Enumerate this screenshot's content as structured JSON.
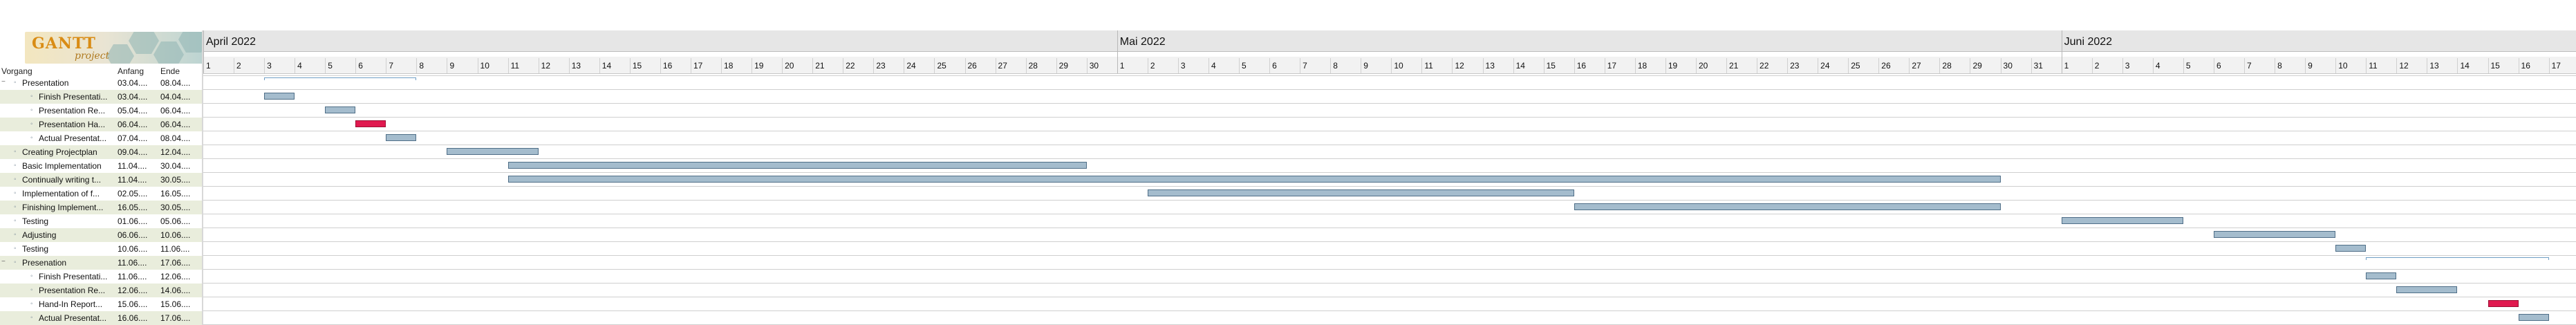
{
  "logo": {
    "text": "GANTT",
    "subtext": "project"
  },
  "table": {
    "headers": {
      "name": "Vorgang",
      "start": "Anfang",
      "end": "Ende"
    },
    "rows": [
      {
        "name": "Presentation",
        "start": "03.04....",
        "end": "08.04....",
        "level": 0,
        "toggle": "−"
      },
      {
        "name": "Finish Presentati...",
        "start": "03.04....",
        "end": "04.04....",
        "level": 1
      },
      {
        "name": "Presentation Re...",
        "start": "05.04....",
        "end": "06.04....",
        "level": 1
      },
      {
        "name": "Presentation Ha...",
        "start": "06.04....",
        "end": "06.04....",
        "level": 1
      },
      {
        "name": "Actual Presentat...",
        "start": "07.04....",
        "end": "08.04....",
        "level": 1
      },
      {
        "name": "Creating Projectplan",
        "start": "09.04....",
        "end": "12.04....",
        "level": 0
      },
      {
        "name": "Basic Implementation",
        "start": "11.04....",
        "end": "30.04....",
        "level": 0
      },
      {
        "name": "Continually writing t...",
        "start": "11.04....",
        "end": "30.05....",
        "level": 0
      },
      {
        "name": "Implementation of f...",
        "start": "02.05....",
        "end": "16.05....",
        "level": 0
      },
      {
        "name": "Finishing Implement...",
        "start": "16.05....",
        "end": "30.05....",
        "level": 0
      },
      {
        "name": "Testing",
        "start": "01.06....",
        "end": "05.06....",
        "level": 0
      },
      {
        "name": "Adjusting",
        "start": "06.06....",
        "end": "10.06....",
        "level": 0
      },
      {
        "name": "Testing",
        "start": "10.06....",
        "end": "11.06....",
        "level": 0
      },
      {
        "name": "Presenation",
        "start": "11.06....",
        "end": "17.06....",
        "level": 0,
        "toggle": "−"
      },
      {
        "name": "Finish Presentati...",
        "start": "11.06....",
        "end": "12.06....",
        "level": 1
      },
      {
        "name": "Presentation Re...",
        "start": "12.06....",
        "end": "14.06....",
        "level": 1
      },
      {
        "name": "Hand-In Report...",
        "start": "15.06....",
        "end": "15.06....",
        "level": 1
      },
      {
        "name": "Actual Presentat...",
        "start": "16.06....",
        "end": "17.06....",
        "level": 1
      }
    ]
  },
  "timeline": {
    "months": [
      {
        "label": "April 2022",
        "days": 30
      },
      {
        "label": "Mai 2022",
        "days": 31
      },
      {
        "label": "Juni 2022",
        "days": 17
      }
    ]
  },
  "chart_data": {
    "type": "gantt",
    "start_date": "2022-04-01",
    "tasks": [
      {
        "name": "Presentation",
        "start": "2022-04-03",
        "end": "2022-04-08",
        "summary": true
      },
      {
        "name": "Finish Presentati...",
        "start": "2022-04-03",
        "end": "2022-04-04"
      },
      {
        "name": "Presentation Re...",
        "start": "2022-04-05",
        "end": "2022-04-06"
      },
      {
        "name": "Presentation Ha...",
        "start": "2022-04-06",
        "end": "2022-04-06",
        "milestone": true
      },
      {
        "name": "Actual Presentat...",
        "start": "2022-04-07",
        "end": "2022-04-08"
      },
      {
        "name": "Creating Projectplan",
        "start": "2022-04-09",
        "end": "2022-04-12"
      },
      {
        "name": "Basic Implementation",
        "start": "2022-04-11",
        "end": "2022-04-30"
      },
      {
        "name": "Continually writing t...",
        "start": "2022-04-11",
        "end": "2022-05-30"
      },
      {
        "name": "Implementation of f...",
        "start": "2022-05-02",
        "end": "2022-05-16"
      },
      {
        "name": "Finishing Implement...",
        "start": "2022-05-16",
        "end": "2022-05-30"
      },
      {
        "name": "Testing",
        "start": "2022-06-01",
        "end": "2022-06-05"
      },
      {
        "name": "Adjusting",
        "start": "2022-06-06",
        "end": "2022-06-10"
      },
      {
        "name": "Testing",
        "start": "2022-06-10",
        "end": "2022-06-11"
      },
      {
        "name": "Presenation",
        "start": "2022-06-11",
        "end": "2022-06-17",
        "summary": true
      },
      {
        "name": "Finish Presentati...",
        "start": "2022-06-11",
        "end": "2022-06-12"
      },
      {
        "name": "Presentation Re...",
        "start": "2022-06-12",
        "end": "2022-06-14"
      },
      {
        "name": "Hand-In Report...",
        "start": "2022-06-15",
        "end": "2022-06-15",
        "milestone": true
      },
      {
        "name": "Actual Presentat...",
        "start": "2022-06-16",
        "end": "2022-06-17"
      }
    ],
    "colors": {
      "task": "#a4bccd",
      "milestone": "#e0194f",
      "summary": "#6f9ec4"
    }
  }
}
